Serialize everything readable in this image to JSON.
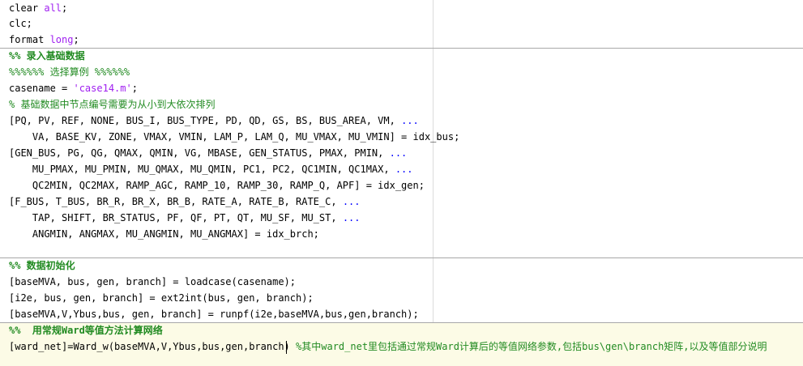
{
  "lines": {
    "l1": {
      "a": "clear ",
      "b": "all",
      "c": ";"
    },
    "l2": {
      "a": "clc;"
    },
    "l3": {
      "a": "format ",
      "b": "long",
      "c": ";"
    },
    "l4": {
      "a": "%% 录入基础数据"
    },
    "l5": {
      "a": "%%%%%% 选择算例 %%%%%%"
    },
    "l6": {
      "a": "casename = ",
      "b": "'case14.m'",
      "c": ";"
    },
    "l7": {
      "a": "% 基础数据中节点编号需要为从小到大依次排列"
    },
    "l8": {
      "a": "[PQ, PV, REF, NONE, BUS_I, BUS_TYPE, PD, QD, GS, BS, BUS_AREA, VM, ",
      "b": "..."
    },
    "l9": {
      "a": "    VA, BASE_KV, ZONE, VMAX, VMIN, LAM_P, LAM_Q, MU_VMAX, MU_VMIN] = idx_bus;"
    },
    "l10": {
      "a": "[GEN_BUS, PG, QG, QMAX, QMIN, VG, MBASE, GEN_STATUS, PMAX, PMIN, ",
      "b": "..."
    },
    "l11": {
      "a": "    MU_PMAX, MU_PMIN, MU_QMAX, MU_QMIN, PC1, PC2, QC1MIN, QC1MAX, ",
      "b": "..."
    },
    "l12": {
      "a": "    QC2MIN, QC2MAX, RAMP_AGC, RAMP_10, RAMP_30, RAMP_Q, APF] = idx_gen;"
    },
    "l13": {
      "a": "[F_BUS, T_BUS, BR_R, BR_X, BR_B, RATE_A, RATE_B, RATE_C, ",
      "b": "..."
    },
    "l14": {
      "a": "    TAP, SHIFT, BR_STATUS, PF, QF, PT, QT, MU_SF, MU_ST, ",
      "b": "..."
    },
    "l15": {
      "a": "    ANGMIN, ANGMAX, MU_ANGMIN, MU_ANGMAX] = idx_brch;"
    },
    "l16": {
      "a": "%% 数据初始化"
    },
    "l17": {
      "a": "[baseMVA, bus, gen, branch] = loadcase(casename);"
    },
    "l18": {
      "a": "[i2e, bus, gen, branch] = ext2int(bus, gen, branch);"
    },
    "l19": {
      "a": "[baseMVA,V,Ybus,bus, gen, branch] = runpf(i2e,baseMVA,bus,gen,branch);"
    },
    "l20": {
      "a": "%%  用常规Ward等值方法计算网络"
    },
    "l21": {
      "a": "[ward_net]=Ward_w(baseMVA,V,Ybus,bus,gen,branch) ",
      "b": "%其中ward_net里包括通过常规Ward计算后的等值网络参数,包括bus\\gen\\branch矩阵,以及等值部分说明"
    }
  }
}
